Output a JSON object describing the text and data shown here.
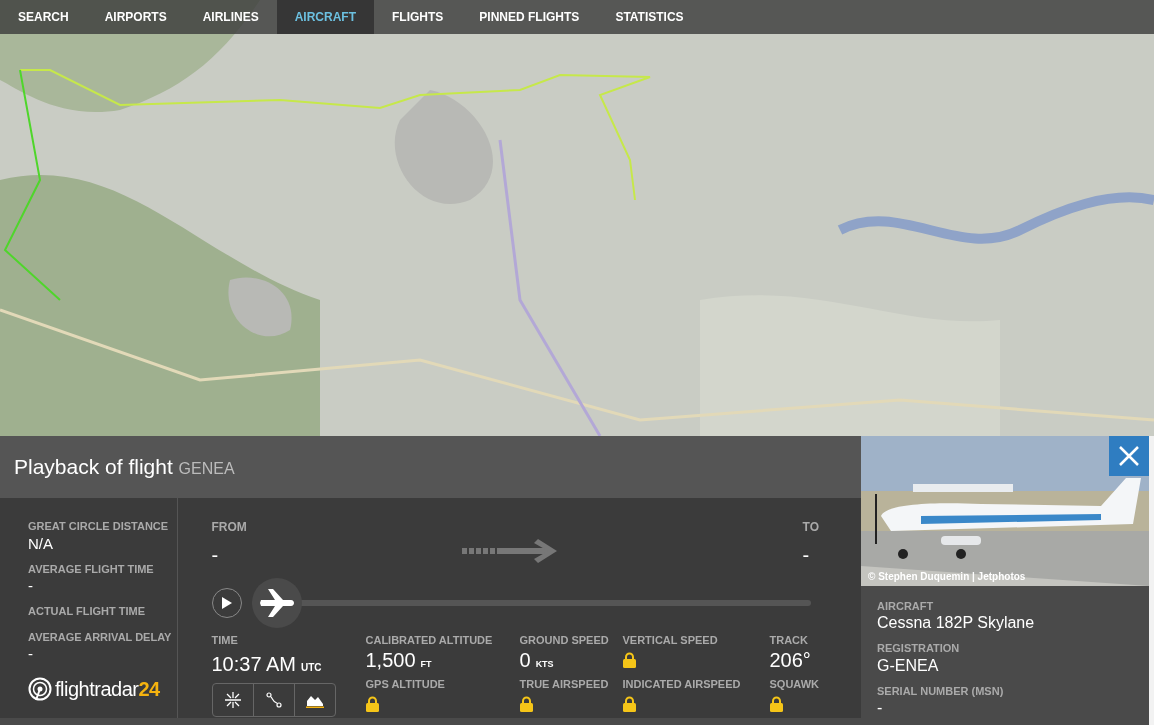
{
  "nav": [
    {
      "label": "SEARCH",
      "selected": false
    },
    {
      "label": "AIRPORTS",
      "selected": false
    },
    {
      "label": "AIRLINES",
      "selected": false
    },
    {
      "label": "AIRCRAFT",
      "selected": true
    },
    {
      "label": "FLIGHTS",
      "selected": false
    },
    {
      "label": "PINNED FLIGHTS",
      "selected": false
    },
    {
      "label": "STATISTICS",
      "selected": false
    }
  ],
  "header": {
    "title": "Playback of flight",
    "callsign": "GENEA"
  },
  "summary": [
    {
      "label": "GREAT CIRCLE DISTANCE",
      "value": "N/A"
    },
    {
      "label": "AVERAGE FLIGHT TIME",
      "value": "-"
    },
    {
      "label": "ACTUAL FLIGHT TIME"
    },
    {
      "label": "AVERAGE ARRIVAL DELAY",
      "value": "-"
    }
  ],
  "logo": {
    "text": "flightradar",
    "accent": "24"
  },
  "route": {
    "from_label": "FROM",
    "from": "-",
    "to_label": "TO",
    "to": "-"
  },
  "playback": {
    "level": 0
  },
  "time": {
    "label": "TIME",
    "value": "10:37 AM",
    "unit": "UTC"
  },
  "stats": [
    {
      "label": "CALIBRATED ALTITUDE",
      "kind": "value",
      "value": "1,500",
      "unit": "FT"
    },
    {
      "label": "GROUND SPEED",
      "kind": "value",
      "value": "0",
      "unit": "KTS"
    },
    {
      "label": "VERTICAL SPEED",
      "kind": "locked"
    },
    {
      "label": "TRACK",
      "kind": "value",
      "value": "206°"
    },
    {
      "label": "GPS ALTITUDE",
      "kind": "locked"
    },
    {
      "label": "TRUE AIRSPEED",
      "kind": "locked"
    },
    {
      "label": "INDICATED AIRSPEED",
      "kind": "locked"
    },
    {
      "label": "SQUAWK",
      "kind": "locked"
    }
  ],
  "photo": {
    "credit": "© Stephen Duquemin | Jetphotos"
  },
  "aircraft": [
    {
      "label": "AIRCRAFT",
      "value": "Cessna 182P Skylane"
    },
    {
      "label": "REGISTRATION",
      "value": "G-ENEA"
    },
    {
      "label": "SERIAL NUMBER (MSN)",
      "value": "-"
    }
  ]
}
